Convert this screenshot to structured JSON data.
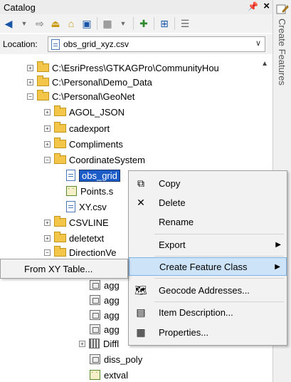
{
  "window": {
    "title": "Catalog",
    "pin": "⁴",
    "close": "×"
  },
  "location": {
    "label": "Location:",
    "value": "obs_grid_xyz.csv"
  },
  "sidetab": {
    "label": "Create Features"
  },
  "tree": [
    {
      "text": "C:\\EsriPress\\GTKAGPro\\CommunityHou",
      "exp": "+"
    },
    {
      "text": "C:\\Personal\\Demo_Data",
      "exp": "+"
    },
    {
      "text": "C:\\Personal\\GeoNet",
      "exp": "−"
    },
    {
      "text": "AGOL_JSON",
      "exp": "+"
    },
    {
      "text": "cadexport",
      "exp": "+"
    },
    {
      "text": "Compliments",
      "exp": "+"
    },
    {
      "text": "CoordinateSystem",
      "exp": "−"
    },
    {
      "text": "obs_grid"
    },
    {
      "text": "Points.s"
    },
    {
      "text": "XY.csv"
    },
    {
      "text": "CSVLINE",
      "exp": "+"
    },
    {
      "text": "deletetxt",
      "exp": "+"
    },
    {
      "text": "DirectionVe",
      "exp": "−"
    },
    {
      "text": "agg"
    },
    {
      "text": "agg"
    },
    {
      "text": "agg"
    },
    {
      "text": "agg"
    },
    {
      "text": "Diffl",
      "exp": "+"
    },
    {
      "text": "diss_poly"
    },
    {
      "text": "extval"
    }
  ],
  "context_menu": {
    "items": [
      {
        "label": "Copy"
      },
      {
        "label": "Delete"
      },
      {
        "label": "Rename"
      },
      {
        "label": "Export"
      },
      {
        "label": "Create Feature Class"
      },
      {
        "label": "Geocode Addresses..."
      },
      {
        "label": "Item Description..."
      },
      {
        "label": "Properties..."
      }
    ]
  },
  "submenu": {
    "label": "From XY Table..."
  },
  "colors": {
    "selection": "#1c5cc8",
    "menu_highlight": "#cde3f8",
    "folder": "#f3c64a"
  }
}
